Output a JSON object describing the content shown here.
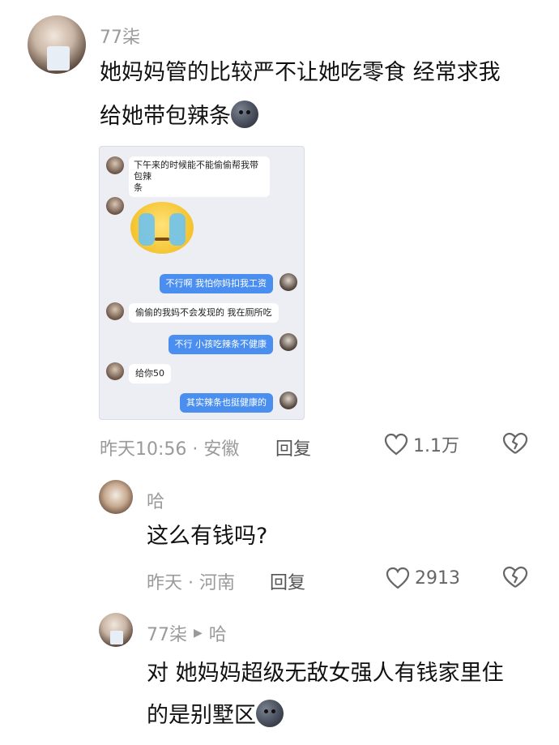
{
  "comments": [
    {
      "name": "77柒",
      "text_line1": "她妈妈管的比较严不让她吃零食 经常求我",
      "text_line2": "给她带包辣条",
      "emoji": "moon-face",
      "meta": "昨天10:56 · 安徽",
      "reply_label": "回复",
      "likes": "1.1万",
      "chat_screenshot": {
        "messages": [
          {
            "side": "left",
            "line1": "下午来的时候能不能偷偷帮我带包辣",
            "line2": "条"
          },
          {
            "side": "left",
            "sticker": "crying-face"
          },
          {
            "side": "right",
            "text": "不行啊 我怕你妈扣我工资"
          },
          {
            "side": "left",
            "text": "偷偷的我妈不会发现的 我在厕所吃"
          },
          {
            "side": "right",
            "text": "不行 小孩吃辣条不健康"
          },
          {
            "side": "left",
            "text": "给你50"
          },
          {
            "side": "right",
            "text": "其实辣条也挺健康的"
          }
        ]
      }
    },
    {
      "name": "哈",
      "text": "这么有钱吗?",
      "meta": "昨天 · 河南",
      "reply_label": "回复",
      "likes": "2913"
    },
    {
      "name": "77柒",
      "reply_to": "哈",
      "text_line1": "对 她妈妈超级无敌女强人有钱家里住",
      "text_line2": "的是别墅区",
      "emoji": "moon-face"
    }
  ],
  "icons": [
    "heart-icon",
    "broken-heart-icon",
    "reply-arrow-icon"
  ]
}
